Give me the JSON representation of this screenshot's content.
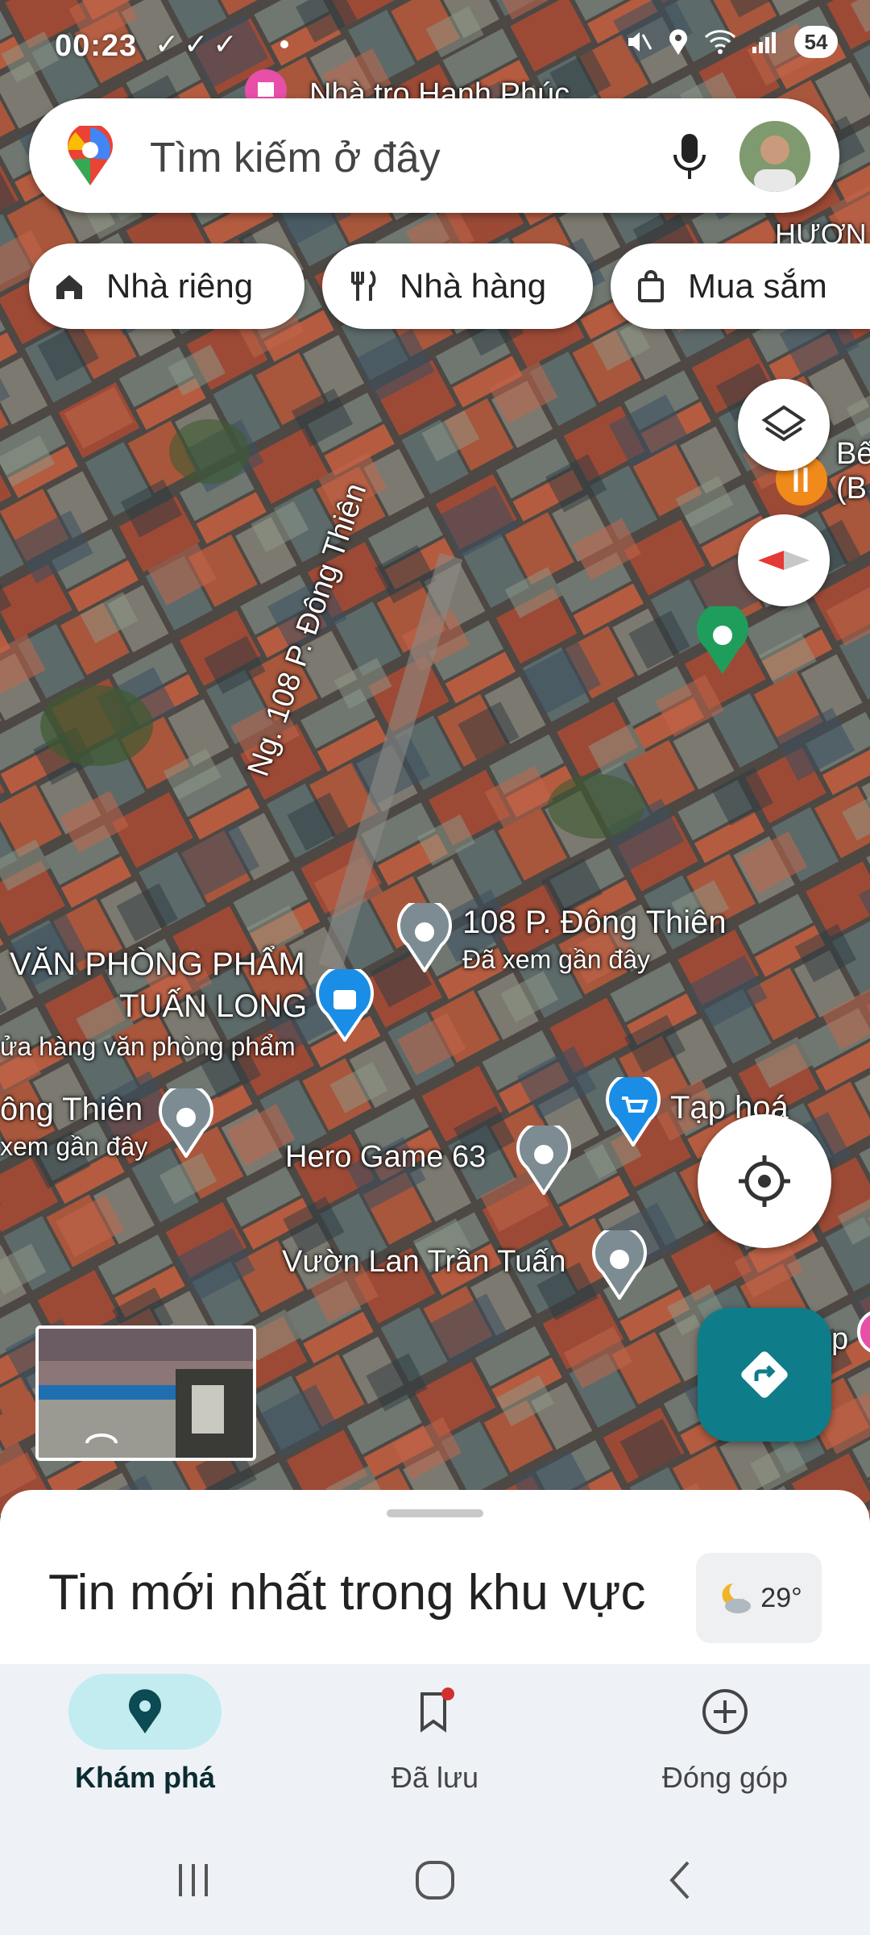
{
  "status_bar": {
    "time": "00:23",
    "checks": "✓✓✓",
    "battery": "54"
  },
  "search": {
    "placeholder": "Tìm kiếm ở đây",
    "mic_icon": "mic-icon",
    "avatar": "profile-avatar"
  },
  "chips": [
    {
      "label": "Nhà riêng",
      "icon": "home-icon"
    },
    {
      "label": "Nhà hàng",
      "icon": "restaurant-icon"
    },
    {
      "label": "Mua sắm",
      "icon": "shopping-bag-icon"
    }
  ],
  "map_labels": {
    "street_top": "Nhà trọ Hạnh Phúc",
    "street_top_right": "HƯƠN",
    "right_poi": "Bế\n(B",
    "road": "Ng. 108 P. Đông Thiên",
    "place1_name": "108 P. Đông Thiên",
    "place1_sub": "Đã xem gần đây",
    "store_name_line1": "VĂN PHÒNG PHẨM",
    "store_name_line2": "TUẤN LONG",
    "store_sub": "ửa hàng văn phòng phẩm",
    "place2_name": "ông Thiên",
    "place2_sub": "xem gần đây",
    "hero": "Hero Game 63",
    "grocery": "Tạp hoá",
    "garden": "Vườn Lan Trần Tuấn",
    "edge_right": "p"
  },
  "sheet": {
    "title": "Tin mới nhất trong khu vực",
    "weather_temp": "29°",
    "weather_icon": "moon-cloud-icon"
  },
  "nav": [
    {
      "label": "Khám phá",
      "icon": "explore-pin-icon",
      "active": true
    },
    {
      "label": "Đã lưu",
      "icon": "bookmark-icon",
      "active": false
    },
    {
      "label": "Đóng góp",
      "icon": "add-circle-icon",
      "active": false
    }
  ],
  "colors": {
    "teal": "#0f7c89",
    "active_pill": "#c2ecf0"
  }
}
